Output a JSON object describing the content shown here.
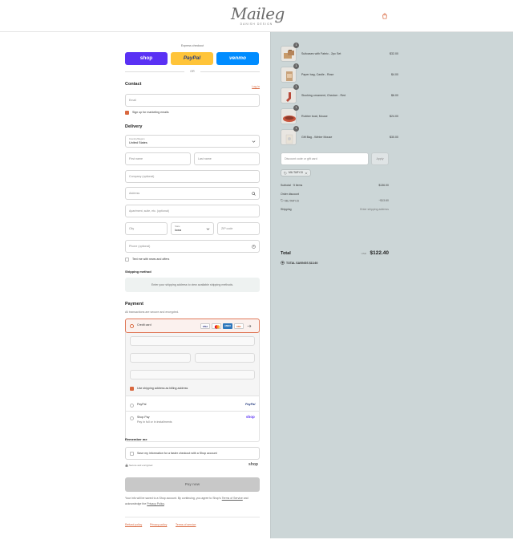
{
  "brand": {
    "name": "Maileg",
    "tagline": "DANISH DESIGN"
  },
  "express": {
    "title": "Express checkout",
    "shop_label": "shop",
    "paypal_label": "PayPal",
    "venmo_label": "venmo",
    "or": "OR"
  },
  "contact": {
    "heading": "Contact",
    "login": "Log in",
    "email_placeholder": "Email",
    "marketing_label": "Sign up for marketing emails"
  },
  "delivery": {
    "heading": "Delivery",
    "country_label": "Country/Region",
    "country_value": "United States",
    "first_name": "First name",
    "last_name": "Last name",
    "company": "Company (optional)",
    "address": "Address",
    "apartment": "Apartment, suite, etc. (optional)",
    "city": "City",
    "state_label": "State",
    "state_value": "Iowa",
    "zip": "ZIP code",
    "phone": "Phone (optional)",
    "text_news": "Text me with news and offers"
  },
  "shipping": {
    "heading": "Shipping method",
    "message": "Enter your shipping address to view available shipping methods."
  },
  "payment": {
    "heading": "Payment",
    "subtitle": "All transactions are secure and encrypted.",
    "credit_card": "Credit card",
    "card_brands": [
      "VISA",
      "MC",
      "AMEX",
      "DISC"
    ],
    "billing_same": "Use shipping address as billing address",
    "paypal": "PayPal",
    "shop_pay": "Shop Pay",
    "shop_pay_sub": "Pay in full or in installments",
    "paypal_logo": "PayPal",
    "shop_logo": "shop"
  },
  "remember": {
    "heading": "Remember me",
    "save_label": "Save my information for a faster checkout with a Shop account",
    "secure": "Secure and encrypted",
    "shop_logo": "shop"
  },
  "pay_now": "Pay now",
  "legal": {
    "text1": "Your info will be saved to a Shop account. By continuing, you agree to Shop's",
    "terms": "Terms of Service",
    "text2": "and acknowledge the",
    "privacy": "Privacy Policy",
    "end": "."
  },
  "footer": [
    "Refund policy",
    "Privacy policy",
    "Terms of service"
  ],
  "summary": {
    "items": [
      {
        "qty": "1",
        "name": "Suitcases with Fabric - 2pc Set",
        "price": "$32.00"
      },
      {
        "qty": "1",
        "name": "Paper bag, Castle - Rose",
        "price": "$4.00"
      },
      {
        "qty": "1",
        "name": "Stocking ornament, Checker - Red",
        "price": "$6.00"
      },
      {
        "qty": "1",
        "name": "Rubber boat, Mouse",
        "price": "$24.00"
      },
      {
        "qty": "1",
        "name": "Gift Bag - Winter Mouse",
        "price": "$30.00"
      }
    ],
    "discount_placeholder": "Discount code or gift card",
    "apply": "Apply",
    "code": "MILITARY15",
    "subtotal_label": "Subtotal · 5 items",
    "subtotal": "$136.00",
    "order_discount_label": "Order discount",
    "discount_code": "MILITARY15",
    "discount_value": "−$13.60",
    "shipping_label": "Shipping",
    "shipping_value": "Enter shipping address",
    "total_label": "Total",
    "currency": "USD",
    "total": "$122.40",
    "savings": "TOTAL SAVINGS  $13.60"
  },
  "colors": {
    "accent": "#d9683f",
    "shop": "#5a31f4",
    "paypal": "#ffc439",
    "venmo": "#008cff",
    "summary_bg": "#ccd6d7"
  }
}
